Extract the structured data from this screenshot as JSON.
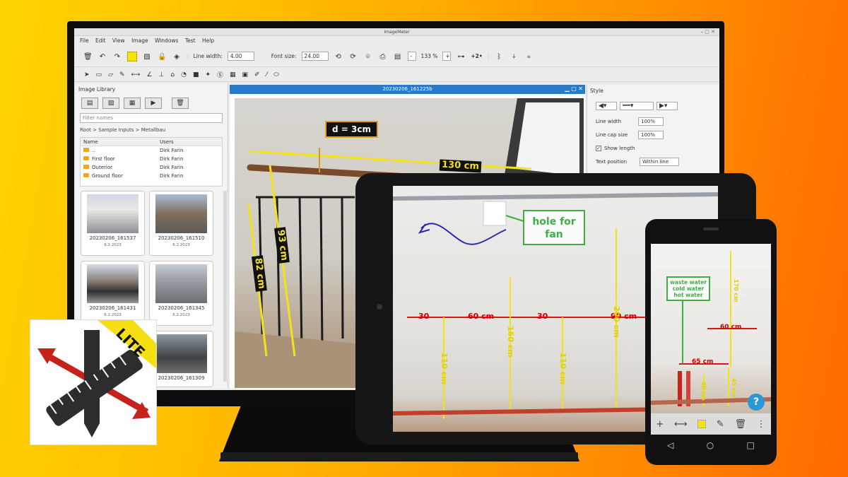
{
  "app": {
    "window_title": "ImageMeter",
    "menu": [
      "File",
      "Edit",
      "View",
      "Image",
      "Windows",
      "Test",
      "Help"
    ],
    "toolbar": {
      "line_width_label": "Line width:",
      "line_width_value": "4.00",
      "font_size_label": "Font size:",
      "font_size_value": "24.00",
      "zoom_minus": "-",
      "zoom_value": "133 %",
      "zoom_plus": "+",
      "plus_two": "+2•"
    }
  },
  "library": {
    "title": "Image Library",
    "filter_placeholder": "Filter names",
    "breadcrumb": "Root > Sample Inputs > Metallbau",
    "columns": [
      "Name",
      "Users"
    ],
    "rows": [
      {
        "name": "..",
        "user": "Dirk Farin"
      },
      {
        "name": "First floor",
        "user": "Dirk Farin"
      },
      {
        "name": "Outerior",
        "user": "Dirk Farin"
      },
      {
        "name": "Ground floor",
        "user": "Dirk Farin"
      }
    ],
    "thumbs": [
      {
        "name": "20230206_161537",
        "date": "6.2.2023"
      },
      {
        "name": "20230206_161510",
        "date": "6.2.2023"
      },
      {
        "name": "20230206_161431",
        "date": "6.2.2023"
      },
      {
        "name": "20230206_161345",
        "date": "6.2.2023"
      },
      {
        "name": "20230206_161309",
        "date": ""
      }
    ]
  },
  "image_window": {
    "title": "20230206_161225b",
    "labels": {
      "diameter": "d = 3cm",
      "length_top": "130 cm",
      "height_a": "93 cm",
      "height_b": "82 cm"
    }
  },
  "style_panel": {
    "title": "Style",
    "line_width_label": "Line width",
    "line_width_value": "100%",
    "line_cap_label": "Line cap size",
    "line_cap_value": "100%",
    "show_length_label": "Show length",
    "text_position_label": "Text position",
    "text_position_value": "Within line"
  },
  "tablet": {
    "note": "hole for fan",
    "dims": {
      "a": "30",
      "b": "60 cm",
      "c": "30",
      "d": "90 cm",
      "v1": "110 cm",
      "v2": "160 cm",
      "v3": "110 cm",
      "v4": "200 cm"
    }
  },
  "phone": {
    "note_line1": "waste water",
    "note_line2": "cold water",
    "note_line3": "hot water",
    "dims": {
      "a": "60 cm",
      "b": "65 cm",
      "v1": "170 cm",
      "v2": "40 cm",
      "v3": "45 cm"
    },
    "help": "?"
  },
  "logo": {
    "badge": "LITE"
  },
  "colors": {
    "accent_blue": "#2a7bc7",
    "annotation_yellow": "#f7e01e",
    "annotation_red": "#d8131a",
    "annotation_green": "#3cb043"
  }
}
